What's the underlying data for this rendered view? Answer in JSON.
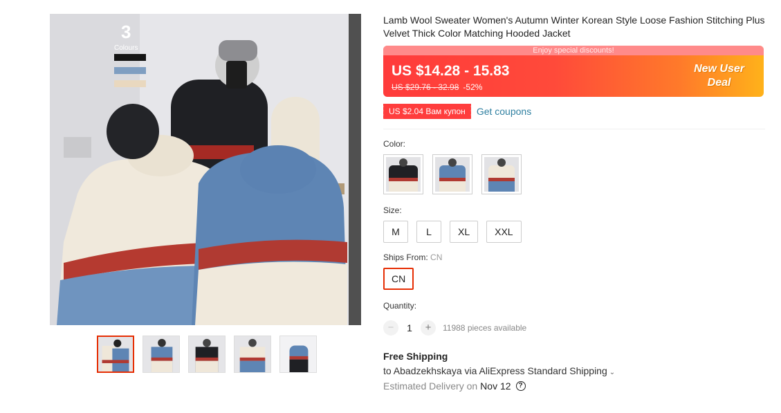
{
  "gallery": {
    "overlay_number": "3",
    "overlay_label": "Colours",
    "thumbnail_count": 5,
    "active_thumbnail": 0
  },
  "product": {
    "title": "Lamb Wool Sweater Women's Autumn Winter Korean Style Loose Fashion Stitching Plus Velvet Thick Color Matching Hooded Jacket"
  },
  "price": {
    "banner_top": "Enjoy special discounts!",
    "current": "US $14.28 - 15.83",
    "original": "US $29.76 - 32.98",
    "discount": "-52%",
    "deal_line1": "New User",
    "deal_line2": "Deal"
  },
  "coupon": {
    "tag": "US $2.04 Вам купон",
    "link": "Get coupons"
  },
  "color": {
    "label": "Color:",
    "swatches": [
      "black",
      "blue",
      "beige"
    ]
  },
  "size": {
    "label": "Size:",
    "options": [
      "M",
      "L",
      "XL",
      "XXL"
    ]
  },
  "ships_from": {
    "label": "Ships From:",
    "value": "CN",
    "option": "CN"
  },
  "quantity": {
    "label": "Quantity:",
    "minus": "−",
    "value": "1",
    "plus": "+",
    "available": "11988 pieces available"
  },
  "shipping": {
    "title": "Free Shipping",
    "line": "to Abadzekhskaya via AliExpress Standard Shipping",
    "delivery_label": "Estimated Delivery on",
    "delivery_date": "Nov 12"
  },
  "colors": {
    "accent_red": "#e62e04",
    "coupon_link": "#2e7fa0",
    "banner_start": "#ff3b3b",
    "banner_end": "#ffb21a"
  }
}
